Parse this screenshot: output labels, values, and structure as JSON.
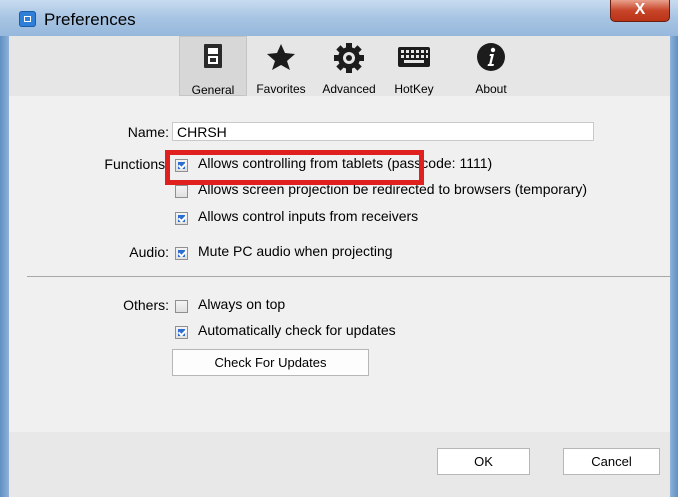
{
  "window": {
    "title": "Preferences",
    "close_label": "X"
  },
  "tabs": [
    {
      "id": "general",
      "label": "General",
      "icon": "general-device-icon",
      "selected": true
    },
    {
      "id": "favorites",
      "label": "Favorites",
      "icon": "star-icon",
      "selected": false
    },
    {
      "id": "advanced",
      "label": "Advanced",
      "icon": "gear-icon",
      "selected": false
    },
    {
      "id": "hotkey",
      "label": "HotKey",
      "icon": "keyboard-icon",
      "selected": false
    },
    {
      "id": "about",
      "label": "About",
      "icon": "info-icon",
      "selected": false
    }
  ],
  "general": {
    "name_label": "Name:",
    "name_value": "CHRSH",
    "functions_label": "Functions:",
    "functions": [
      {
        "text": "Allows controlling from tablets (passcode: 1111)",
        "checked": true
      },
      {
        "text": "Allows screen projection be redirected to browsers (temporary)",
        "checked": false
      },
      {
        "text": "Allows control inputs from receivers",
        "checked": true
      }
    ],
    "audio_label": "Audio:",
    "audio": {
      "text": "Mute PC audio when projecting",
      "checked": true
    },
    "others_label": "Others:",
    "others": [
      {
        "text": "Always on top",
        "checked": false
      },
      {
        "text": "Automatically check for updates",
        "checked": true
      }
    ],
    "check_updates_button": "Check For Updates"
  },
  "footer": {
    "ok_label": "OK",
    "cancel_label": "Cancel"
  },
  "colors": {
    "highlight": "#e0201e",
    "checkbox_fill": "#2e6dd0",
    "title_bar": "#a7c4e3"
  }
}
